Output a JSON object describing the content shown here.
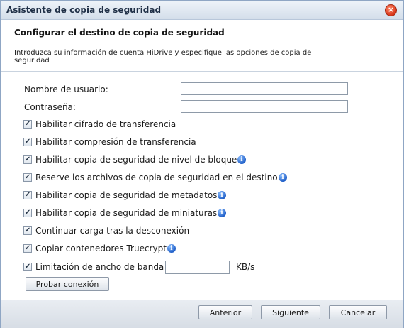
{
  "dialog": {
    "title": "Asistente de copia de seguridad",
    "close_icon": "close-icon"
  },
  "header": {
    "title": "Configurar el destino de copia de seguridad",
    "description": "Introduzca su información de cuenta HiDrive y especifique las opciones de copia de seguridad"
  },
  "form": {
    "username_label": "Nombre de usuario:",
    "username_value": "",
    "password_label": "Contraseña:",
    "password_value": ""
  },
  "options": [
    {
      "label": "Habilitar cifrado de transferencia",
      "checked": true,
      "info": false
    },
    {
      "label": "Habilitar compresión de transferencia",
      "checked": true,
      "info": false
    },
    {
      "label": "Habilitar copia de seguridad de nivel de bloque",
      "checked": true,
      "info": true
    },
    {
      "label": "Reserve los archivos de copia de seguridad en el destino",
      "checked": true,
      "info": true
    },
    {
      "label": "Habilitar copia de seguridad de metadatos",
      "checked": true,
      "info": true
    },
    {
      "label": "Habilitar copia de seguridad de miniaturas",
      "checked": true,
      "info": true
    },
    {
      "label": "Continuar carga tras la desconexión",
      "checked": true,
      "info": false
    },
    {
      "label": "Copiar contenedores Truecrypt",
      "checked": true,
      "info": true
    }
  ],
  "bandwidth": {
    "label": "Limitación de ancho de banda",
    "checked": true,
    "value": "",
    "unit": "KB/s"
  },
  "test_button": "Probar conexión",
  "footer": {
    "back": "Anterior",
    "next": "Siguiente",
    "cancel": "Cancelar"
  },
  "colors": {
    "info_icon": "#2a6fd6",
    "close_icon": "#e04a2a"
  }
}
